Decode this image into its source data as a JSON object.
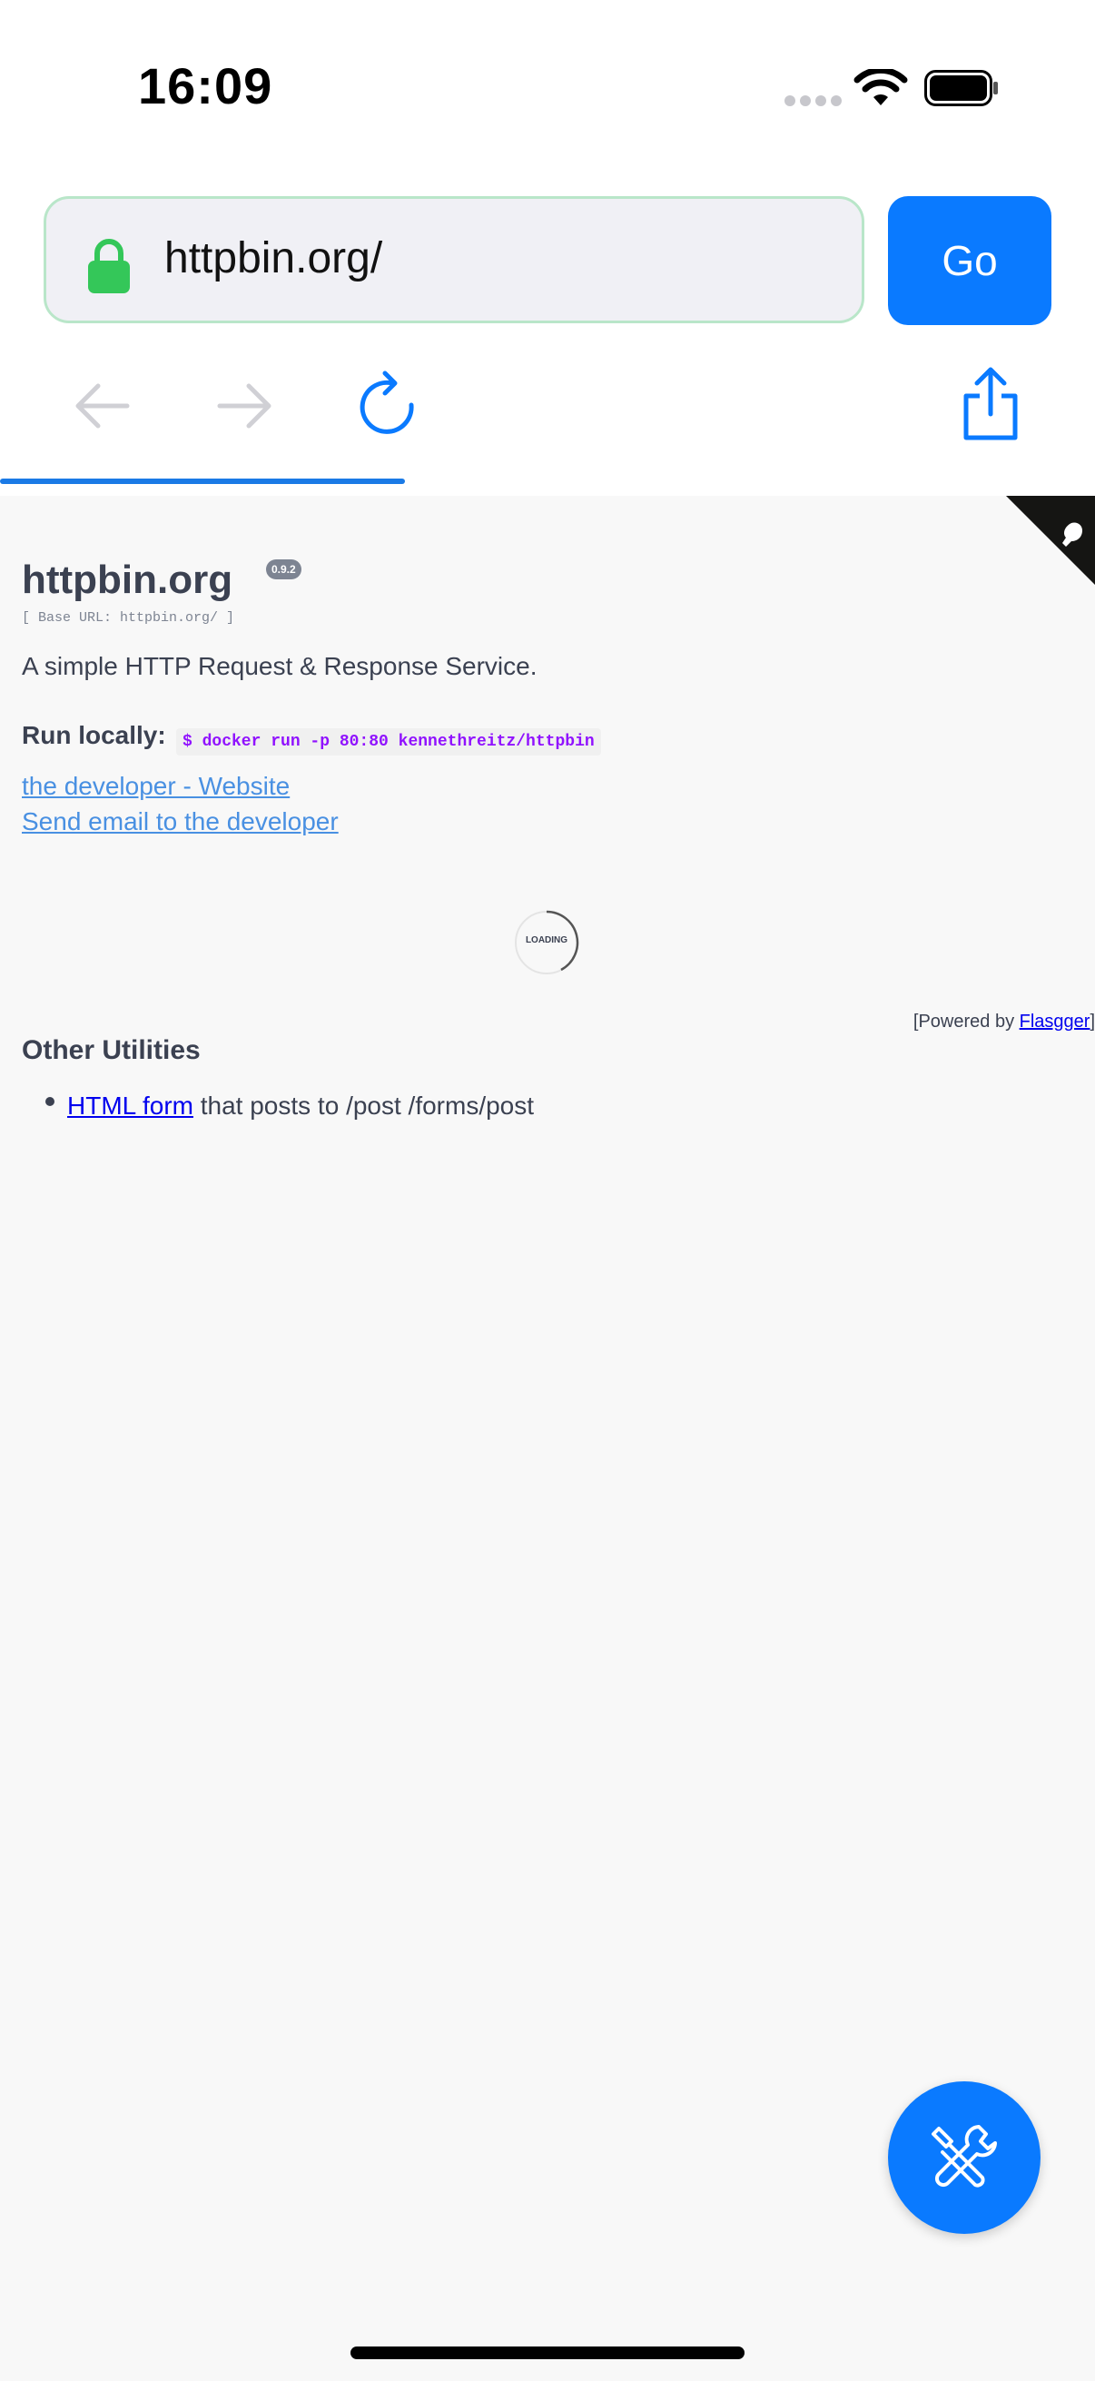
{
  "status_bar": {
    "time": "16:09"
  },
  "browser": {
    "url": "httpbin.org/",
    "go_label": "Go",
    "load_progress_percent": 37
  },
  "page": {
    "title": "httpbin.org",
    "version": "0.9.2",
    "base_url": "[ Base URL: httpbin.org/ ]",
    "description": "A simple HTTP Request & Response Service.",
    "run_locally_label": "Run locally:",
    "run_command": "$ docker run -p 80:80 kennethreitz/httpbin",
    "links": [
      "the developer - Website",
      "Send email to the developer"
    ],
    "loading_text": "LOADING",
    "powered_prefix": "[Powered by ",
    "powered_link": "Flasgger",
    "powered_suffix": "]",
    "other_utilities_heading": "Other Utilities",
    "utilities": [
      {
        "link": "HTML form",
        "text": " that posts to /post /forms/post"
      }
    ]
  },
  "colors": {
    "accent": "#0a7aff",
    "link": "#4990e2",
    "command": "#9012fe",
    "text": "#3b4151"
  }
}
